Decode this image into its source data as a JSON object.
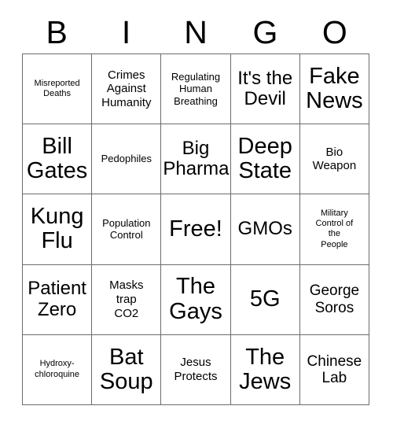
{
  "card": {
    "header": {
      "letters": [
        "B",
        "I",
        "N",
        "G",
        "O"
      ]
    },
    "grid": {
      "rows": 5,
      "columns": 5,
      "border_color": "#6b6b6b",
      "background_color": "#ffffff",
      "text_color": "#000000",
      "cells": [
        {
          "text": "Misreported\nDeaths",
          "size": "fs-xs",
          "free": false
        },
        {
          "text": "Crimes\nAgainst\nHumanity",
          "size": "fs-md",
          "free": false
        },
        {
          "text": "Regulating\nHuman\nBreathing",
          "size": "fs-sm",
          "free": false
        },
        {
          "text": "It's the\nDevil",
          "size": "fs-xl",
          "free": false
        },
        {
          "text": "Fake\nNews",
          "size": "fs-xxl",
          "free": false
        },
        {
          "text": "Bill\nGates",
          "size": "fs-xxl",
          "free": false
        },
        {
          "text": "Pedophiles",
          "size": "fs-sm",
          "free": false
        },
        {
          "text": "Big\nPharma",
          "size": "fs-xl",
          "free": false
        },
        {
          "text": "Deep\nState",
          "size": "fs-xxl",
          "free": false
        },
        {
          "text": "Bio\nWeapon",
          "size": "fs-md",
          "free": false
        },
        {
          "text": "Kung\nFlu",
          "size": "fs-xxl",
          "free": false
        },
        {
          "text": "Population\nControl",
          "size": "fs-sm",
          "free": false
        },
        {
          "text": "Free!",
          "size": "fs-xxl",
          "free": true
        },
        {
          "text": "GMOs",
          "size": "fs-xl",
          "free": false
        },
        {
          "text": "Military\nControl of\nthe\nPeople",
          "size": "fs-xs",
          "free": false
        },
        {
          "text": "Patient\nZero",
          "size": "fs-xl",
          "free": false
        },
        {
          "text": "Masks\ntrap\nCO2",
          "size": "fs-md",
          "free": false
        },
        {
          "text": "The\nGays",
          "size": "fs-xxl",
          "free": false
        },
        {
          "text": "5G",
          "size": "fs-xxl",
          "free": false
        },
        {
          "text": "George\nSoros",
          "size": "fs-lg",
          "free": false
        },
        {
          "text": "Hydroxy-\nchloroquine",
          "size": "fs-xs",
          "free": false
        },
        {
          "text": "Bat\nSoup",
          "size": "fs-xxl",
          "free": false
        },
        {
          "text": "Jesus\nProtects",
          "size": "fs-md",
          "free": false
        },
        {
          "text": "The\nJews",
          "size": "fs-xxl",
          "free": false
        },
        {
          "text": "Chinese\nLab",
          "size": "fs-lg",
          "free": false
        }
      ]
    }
  }
}
